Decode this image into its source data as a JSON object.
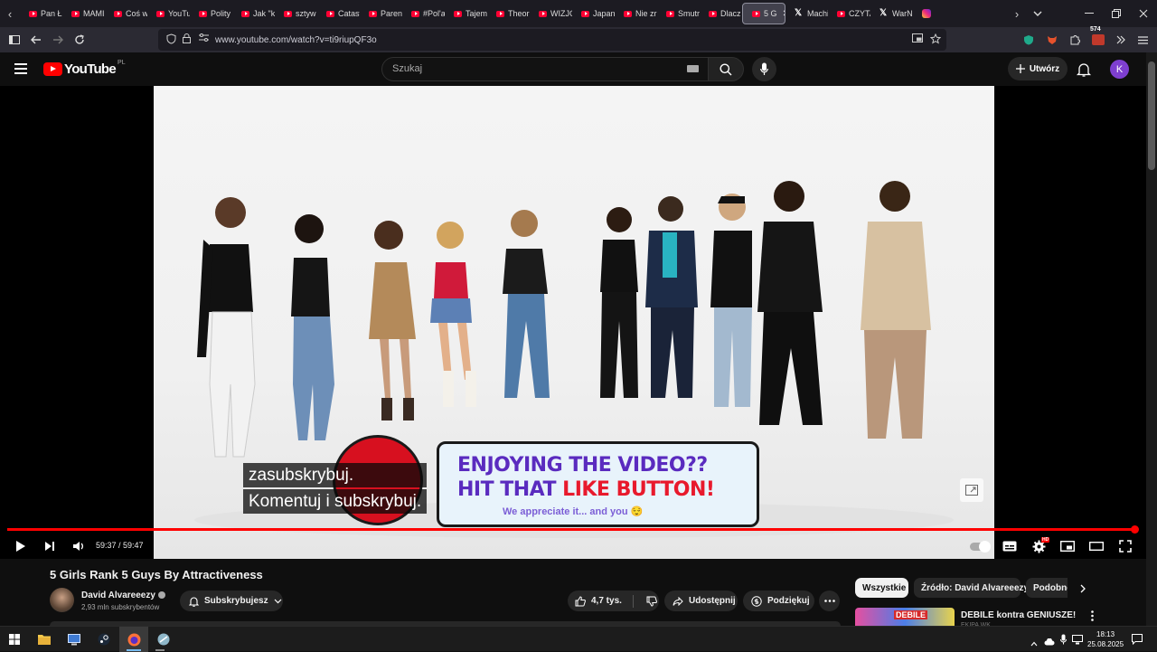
{
  "browser": {
    "tabs": [
      {
        "label": "Pan Ł",
        "icon": "youtube-icon"
      },
      {
        "label": "MAMI",
        "icon": "youtube-icon"
      },
      {
        "label": "Coś w",
        "icon": "youtube-icon"
      },
      {
        "label": "YouTu",
        "icon": "youtube-icon"
      },
      {
        "label": "Polity",
        "icon": "youtube-icon"
      },
      {
        "label": "Jak \"k",
        "icon": "youtube-icon"
      },
      {
        "label": "sztyw",
        "icon": "youtube-icon"
      },
      {
        "label": "Catast",
        "icon": "youtube-icon"
      },
      {
        "label": "Parent",
        "icon": "youtube-icon"
      },
      {
        "label": "#Pol'a",
        "icon": "youtube-icon"
      },
      {
        "label": "Tajem",
        "icon": "youtube-icon"
      },
      {
        "label": "Theor",
        "icon": "youtube-icon"
      },
      {
        "label": "WIZJO",
        "icon": "youtube-icon"
      },
      {
        "label": "Japan",
        "icon": "youtube-icon"
      },
      {
        "label": "Nie zr",
        "icon": "youtube-icon"
      },
      {
        "label": "Smutr",
        "icon": "youtube-icon"
      },
      {
        "label": "Dlacz",
        "icon": "youtube-icon"
      },
      {
        "label": "5 G",
        "icon": "youtube-icon",
        "active": true
      },
      {
        "label": "Machi",
        "icon": "x-icon"
      },
      {
        "label": "CZYTA",
        "icon": "youtube-icon"
      },
      {
        "label": "WarN",
        "icon": "x-icon"
      },
      {
        "label": "",
        "icon": "instagram-icon"
      }
    ],
    "url": "www.youtube.com/watch?v=ti9riupQF3o",
    "extension_badge": "574"
  },
  "youtube": {
    "logo_word": "YouTube",
    "country_code": "PL",
    "search_placeholder": "Szukaj",
    "create_label": "Utwórz",
    "avatar_letter": "K"
  },
  "player": {
    "time_display": "59:37 / 59:47",
    "progress_fraction": 0.997,
    "captions": [
      "zasubskrybuj.",
      "Komentuj i subskrybuj."
    ],
    "banner": {
      "line1": "ENJOYING THE VIDEO??",
      "line2_a": "HIT THAT ",
      "line2_b": "LIKE BUTTON!",
      "line3": "We appreciate it... and you 😌"
    },
    "settings_badge": "HD"
  },
  "video": {
    "title": "5 Girls Rank 5 Guys By Attractiveness",
    "channel_name": "David Alvareeezy",
    "subscriber_count": "2,93 mln subskrybentów",
    "subscribed_label": "Subskrybujesz",
    "likes": "4,7 tys.",
    "share_label": "Udostępnij",
    "thanks_label": "Podziękuj"
  },
  "chips": [
    {
      "label": "Wszystkie",
      "active": true
    },
    {
      "label": "Źródło: David Alvareeezy",
      "active": false
    },
    {
      "label": "Podobne",
      "active": false
    }
  ],
  "recommendation": {
    "title": "DEBILE kontra GENIUSZE!",
    "thumb_text": "DEBILE",
    "channel": "EKIPA WK"
  },
  "taskbar": {
    "time": "18:13",
    "date": "25.08.2025"
  },
  "colors": {
    "yt_red": "#ff0000",
    "progress": "#ff0000",
    "banner_purple": "#5a2bbf",
    "banner_red": "#e8192c",
    "avatar": "#7e3fd0"
  }
}
